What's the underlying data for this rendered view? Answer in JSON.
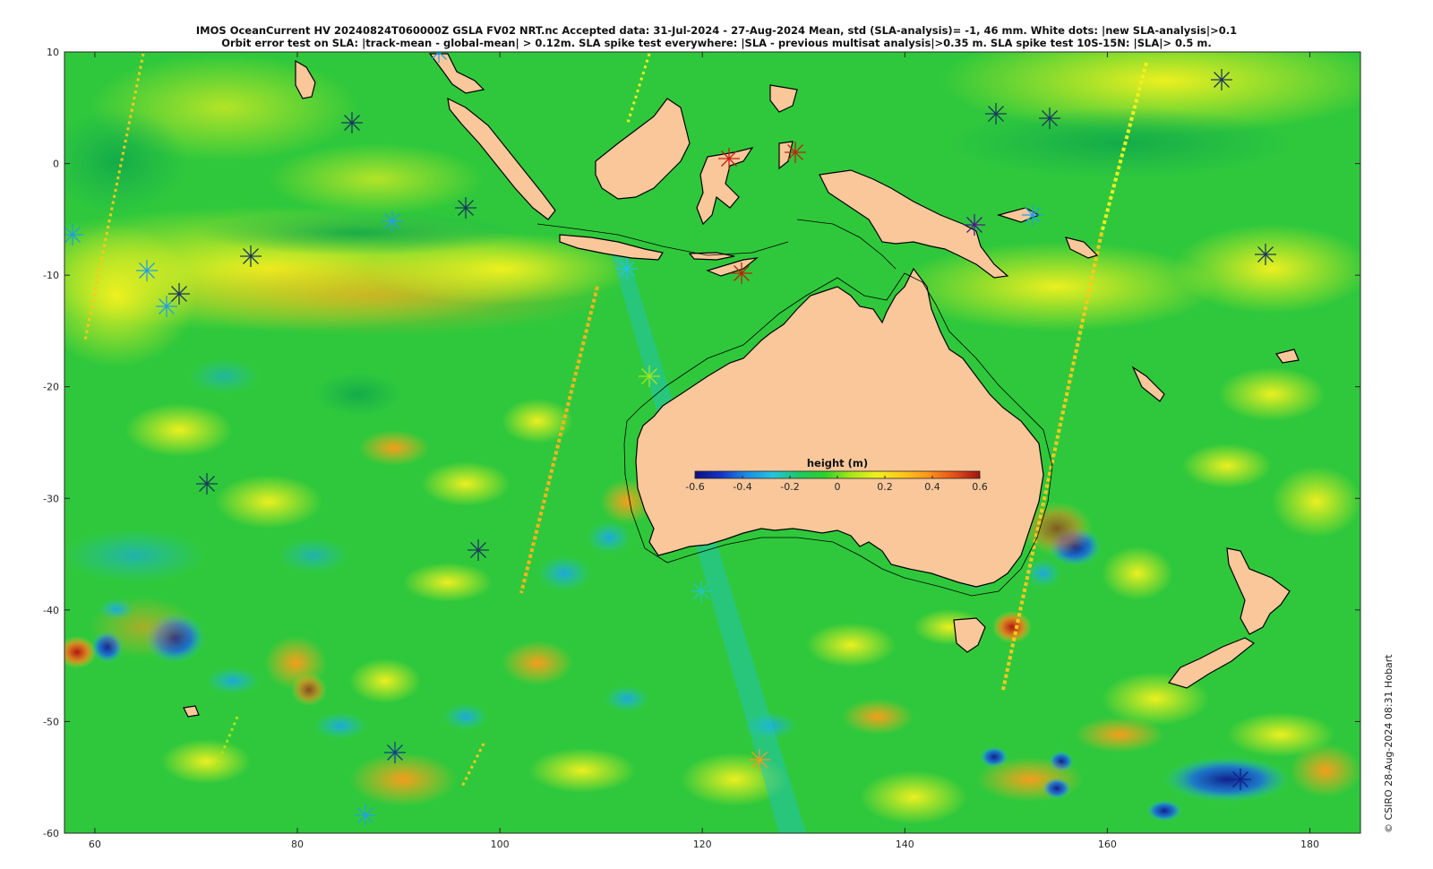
{
  "title": {
    "line1": "IMOS OceanCurrent HV 20240824T060000Z GSLA FV02 NRT.nc  Accepted data: 31-Jul-2024 - 27-Aug-2024 Mean, std (SLA-analysis)= -1, 46 mm. White dots: |new SLA-analysis|>0.1",
    "line2": "Orbit error test on SLA: |track-mean  - global-mean| > 0.12m.  SLA spike test everywhere: |SLA - previous multisat analysis|>0.35 m. SLA spike test 10S-15N: |SLA|> 0.5 m."
  },
  "axes": {
    "x_ticks": [
      "60",
      "80",
      "100",
      "120",
      "140",
      "160",
      "180"
    ],
    "y_ticks": [
      "10",
      "0",
      "-10",
      "-20",
      "-30",
      "-40",
      "-50",
      "-60"
    ],
    "x_values": [
      60,
      80,
      100,
      120,
      140,
      160,
      180
    ],
    "y_values": [
      10,
      0,
      -10,
      -20,
      -30,
      -40,
      -50,
      -60
    ],
    "lon_range": [
      57,
      185
    ],
    "lat_range": [
      -60,
      10
    ]
  },
  "colorbar": {
    "title": "height (m)",
    "tick_labels": [
      "-0.6",
      "-0.4",
      "-0.2",
      "0",
      "0.2",
      "0.4",
      "0.6"
    ],
    "tick_values": [
      -0.6,
      -0.4,
      -0.2,
      0,
      0.2,
      0.4,
      0.6
    ],
    "range": [
      -0.6,
      0.6
    ],
    "colormap": [
      "#0d0d80",
      "#1433c8",
      "#1a8ce6",
      "#22c4e0",
      "#1ec864",
      "#29d229",
      "#a6e619",
      "#f0f01e",
      "#ffc81a",
      "#ff961a",
      "#e6501a",
      "#a01410"
    ]
  },
  "credit": "© CSIRO 28-Aug-2024 08:31 Hobart",
  "colors": {
    "land": "#f9c79a",
    "ocean_base": "#2fc83c",
    "coast": "#000000",
    "frame": "#262626"
  }
}
